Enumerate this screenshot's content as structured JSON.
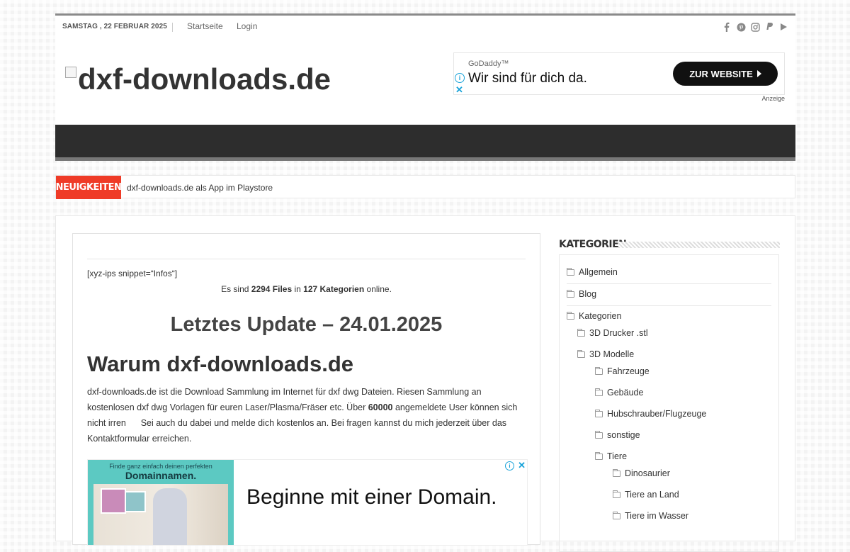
{
  "topbar": {
    "date": "SAMSTAG , 22 FEBRUAR 2025",
    "nav": [
      "Startseite",
      "Login"
    ],
    "social_icons": [
      "facebook-icon",
      "pinterest-icon",
      "instagram-icon",
      "paypal-icon",
      "youtube-icon"
    ]
  },
  "header": {
    "logo_alt": "dxf-downloads.de",
    "ad": {
      "brand": "GoDaddy™",
      "message": "Wir sind für dich da.",
      "cta": "ZUR WEBSITE",
      "label": "Anzeige"
    }
  },
  "ticker": {
    "label": "NEUIGKEITEN",
    "item": "dxf-downloads.de als App im Playstore"
  },
  "post": {
    "snippet": "[xyz-ips snippet=“Infos“]",
    "stats": {
      "prefix": "Es sind ",
      "files": "2294 Files",
      "mid": " in ",
      "cats": "127 Kategorien",
      "suffix": " online."
    },
    "update": "Letztes Update – 24.01.2025",
    "why_heading": "Warum dxf-downloads.de",
    "desc": {
      "part1": "dxf-downloads.de ist die Download Sammlung im Internet für dxf dwg Dateien. Riesen Sammlung an kostenlosen dxf dwg Vorlagen für euren Laser/Plasma/Fräser etc. Über ",
      "users": "60000",
      "part2": " angemeldete User können sich nicht irren      Sei auch du dabei und melde dich kostenlos an. Bei fragen kannst du mich jederzeit über das Kontaktformular erreichen."
    },
    "ad": {
      "line1": "Finde ganz einfach deinen perfekten",
      "line2": "Domainnamen.",
      "headline": "Beginne mit einer Domain."
    }
  },
  "sidebar": {
    "title": "KATEGORIEN",
    "categories": [
      "Allgemein",
      "Blog",
      "Kategorien",
      "3D Drucker .stl",
      "3D Modelle",
      "Fahrzeuge",
      "Gebäude",
      "Hubschrauber/Flugzeuge",
      "sonstige",
      "Tiere",
      "Dinosaurier",
      "Tiere an Land",
      "Tiere im Wasser"
    ]
  },
  "colors": {
    "accent": "#ef3b27",
    "nav_bg": "#2d2d2d",
    "ad_info": "#1aa3d9"
  }
}
